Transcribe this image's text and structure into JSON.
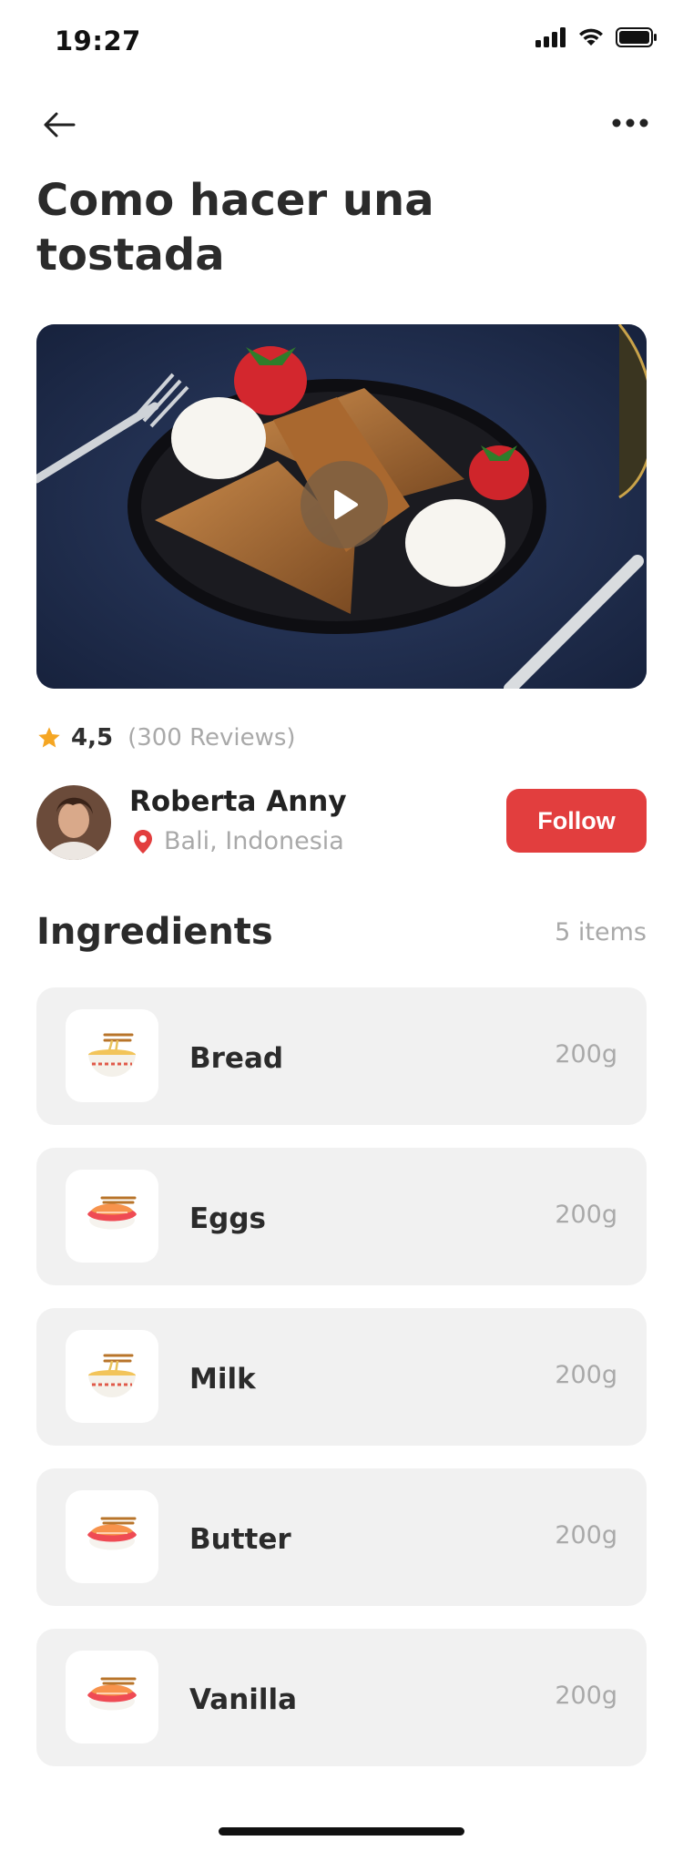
{
  "status_bar": {
    "time": "19:27",
    "icons": [
      "signal-icon",
      "wifi-icon",
      "battery-icon"
    ]
  },
  "header": {
    "back_icon": "arrow-left-icon",
    "more_icon": "more-horizontal-icon"
  },
  "recipe": {
    "title": "Como hacer una tostada",
    "media_play_icon": "play-icon",
    "rating": "4,5",
    "reviews": "(300 Reviews)"
  },
  "author": {
    "name": "Roberta Anny",
    "location": "Bali, Indonesia",
    "follow_label": "Follow"
  },
  "ingredients": {
    "title": "Ingredients",
    "count": "5 items",
    "items": [
      {
        "name": "Bread",
        "quantity": "200g",
        "icon": "noodle-bowl-icon"
      },
      {
        "name": "Eggs",
        "quantity": "200g",
        "icon": "sushi-icon"
      },
      {
        "name": "Milk",
        "quantity": "200g",
        "icon": "noodle-bowl-icon"
      },
      {
        "name": "Butter",
        "quantity": "200g",
        "icon": "sushi-icon"
      },
      {
        "name": "Vanilla",
        "quantity": "200g",
        "icon": "sushi-icon"
      }
    ]
  },
  "colors": {
    "accent": "#e23e3e",
    "star": "#f5a623",
    "card_bg": "#f1f1f1",
    "muted_text": "#a9a9a9"
  }
}
